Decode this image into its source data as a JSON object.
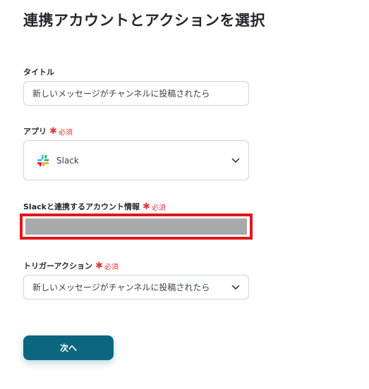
{
  "page": {
    "title": "連携アカウントとアクションを選択"
  },
  "required_text": "必須",
  "required_star": "✱",
  "fields": {
    "title": {
      "label": "タイトル",
      "value": "新しいメッセージがチャンネルに投稿されたら"
    },
    "app": {
      "label": "アプリ",
      "value": "Slack",
      "icon": "slack-logo-icon"
    },
    "account": {
      "label": "Slackと連携するアカウント情報"
    },
    "trigger": {
      "label": "トリガーアクション",
      "value": "新しいメッセージがチャンネルに投稿されたら"
    }
  },
  "next_button": {
    "label": "次へ"
  },
  "colors": {
    "accent": "#0c6680",
    "required": "#e5383b",
    "highlight": "#e0181e"
  }
}
